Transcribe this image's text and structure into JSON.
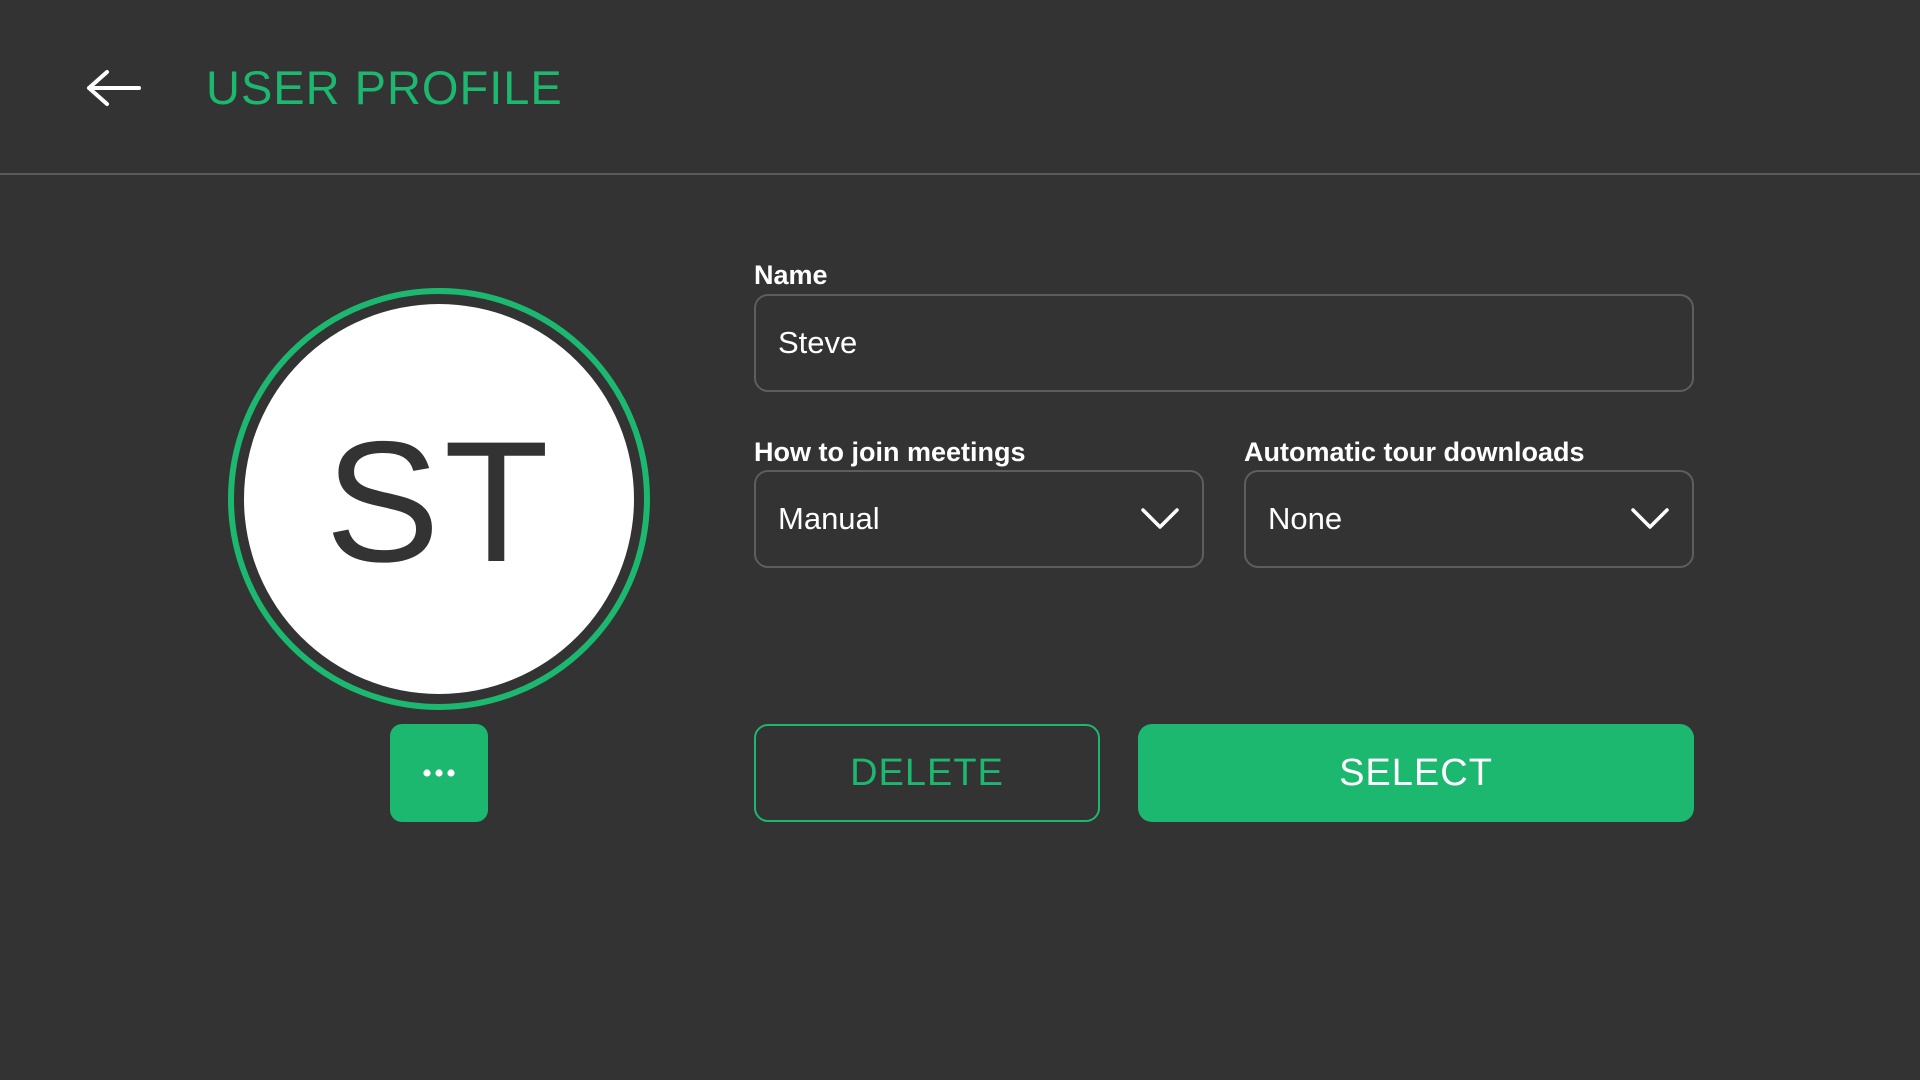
{
  "header": {
    "title": "USER PROFILE",
    "back_icon": "arrow-left-icon"
  },
  "avatar": {
    "initials": "ST",
    "more_icon": "ellipsis-icon"
  },
  "form": {
    "name": {
      "label": "Name",
      "value": "Steve"
    },
    "join_meetings": {
      "label": "How to join meetings",
      "selected": "Manual",
      "icon": "chevron-down-icon"
    },
    "tour_downloads": {
      "label": "Automatic tour downloads",
      "selected": "None",
      "icon": "chevron-down-icon"
    }
  },
  "actions": {
    "delete_label": "DELETE",
    "select_label": "SELECT"
  },
  "colors": {
    "background": "#333333",
    "accent": "#1db870",
    "text": "#ffffff",
    "border": "#5e5e5e"
  }
}
